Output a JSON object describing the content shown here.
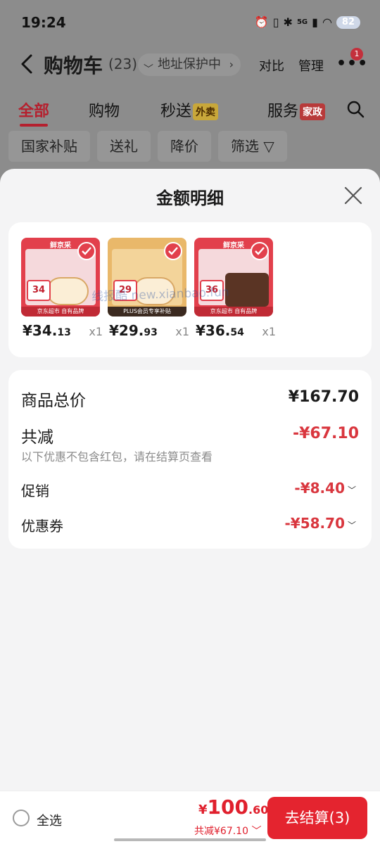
{
  "status_bar": {
    "time": "19:24",
    "network": "5G",
    "battery": "82"
  },
  "header": {
    "title": "购物车",
    "count": "(23)",
    "address_pill": "地址保护中",
    "compare_label": "对比",
    "manage_label": "管理",
    "more_badge": "1"
  },
  "tabs": [
    {
      "label": "全部"
    },
    {
      "label": "购物"
    },
    {
      "label": "秒送",
      "badge": "外卖"
    },
    {
      "label": "服务",
      "badge": "家政"
    }
  ],
  "filters": [
    "国家补贴",
    "送礼",
    "降价",
    "筛选"
  ],
  "sheet": {
    "title": "金额明细",
    "products": [
      {
        "price_main": "¥34.",
        "price_dec": "13",
        "qty": "x1",
        "brand": "鲜京采",
        "tag": "34",
        "footer": "京东超市 自有品牌"
      },
      {
        "price_main": "¥29.",
        "price_dec": "93",
        "qty": "x1",
        "brand": "",
        "tag": "29",
        "footer": "PLUS会员专享补贴"
      },
      {
        "price_main": "¥36.",
        "price_dec": "54",
        "qty": "x1",
        "brand": "鲜京采",
        "tag": "36",
        "footer": "京东超市 自有品牌"
      }
    ],
    "watermark": "线报酷 new.xianbao.fun",
    "summary": {
      "total_label": "商品总价",
      "total_value": "¥167.70",
      "discount_label": "共减",
      "discount_value": "-¥67.10",
      "discount_note": "以下优惠不包含红包，请在结算页查看",
      "promo_label": "促销",
      "promo_value": "-¥8.40",
      "coupon_label": "优惠券",
      "coupon_value": "-¥58.70"
    }
  },
  "bottom_bar": {
    "select_all": "全选",
    "total_yen": "¥",
    "total_int": "100",
    "total_dec": ".60",
    "saving": "共减¥67.10",
    "checkout": "去结算(3)"
  },
  "colors": {
    "accent": "#e4242f",
    "discount": "#d9363e"
  }
}
